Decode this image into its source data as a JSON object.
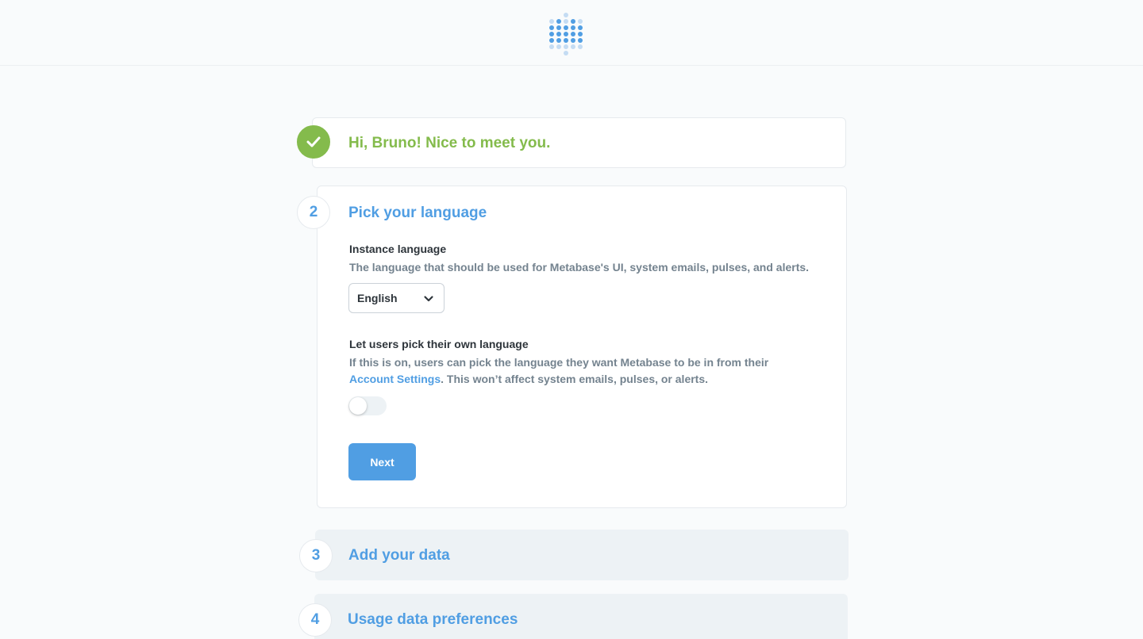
{
  "app": {
    "logo_icon": "metabase-logo-icon"
  },
  "steps": {
    "welcome": {
      "title": "Hi, Bruno! Nice to meet you.",
      "status_icon": "check-icon"
    },
    "language": {
      "number": "2",
      "title": "Pick your language",
      "instance_label": "Instance language",
      "instance_desc": "The language that should be used for Metabase's UI, system emails, pulses, and alerts.",
      "select_value": "English",
      "user_lang_label": "Let users pick their own language",
      "user_lang_desc_before": "If this is on, users can pick the language they want Metabase to be in from their ",
      "user_lang_link": "Account Settings",
      "user_lang_desc_after": ". This won’t affect system emails, pulses, or alerts.",
      "toggle_on": false,
      "next_label": "Next"
    },
    "data": {
      "number": "3",
      "title": "Add your data"
    },
    "usage": {
      "number": "4",
      "title": "Usage data preferences"
    }
  },
  "colors": {
    "brand": "#509ee3",
    "success": "#84bb4c",
    "text_medium": "#74838f"
  }
}
